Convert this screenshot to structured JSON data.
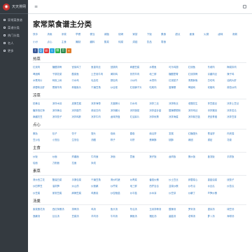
{
  "brand": {
    "name": "天天排网"
  },
  "sidebar": {
    "items": [
      {
        "label": "家常菜食谱"
      },
      {
        "label": "菜谱分类"
      },
      {
        "label": "热门分类"
      },
      {
        "label": "名人"
      },
      {
        "label": "更多"
      }
    ]
  },
  "topbar": {
    "toggle": "≡"
  },
  "page": {
    "title": "家常菜食谱主分类"
  },
  "alpha": [
    "快手",
    "汤羹",
    "凉菜",
    "早餐",
    "便当",
    "减脂",
    "烧烤",
    "家宴",
    "下饭",
    "素食",
    "甜点",
    "面食",
    "火锅",
    "卤味",
    "汤粥",
    "小炒",
    "点心",
    "主食",
    "腌制",
    "酱料",
    "蒸菜",
    "炖菜",
    "烘焙",
    "饮品",
    "零食"
  ],
  "share": [
    {
      "label": "f",
      "color": "#3b5998"
    },
    {
      "label": "Q",
      "color": "#4ca0e0"
    },
    {
      "label": "W",
      "color": "#e0373a"
    },
    {
      "label": "t",
      "color": "#2ea7e0"
    },
    {
      "label": "微",
      "color": "#2eb24b"
    },
    {
      "label": "豆",
      "color": "#2c8c4e"
    },
    {
      "label": "+",
      "color": "#e07b28"
    }
  ],
  "sections": [
    {
      "title": "热菜",
      "links": [
        "红烧肉",
        "糖醋排骨",
        "宫保鸡丁",
        "鱼香肉丝",
        "回锅肉",
        "麻婆豆腐",
        "水煮鱼",
        "可乐鸡翅",
        "红烧鱼",
        "东坡肉",
        "梅菜扣肉",
        "啤酒鸭",
        "干锅花菜",
        "酸菜鱼",
        "土豆烧牛肉",
        "黄焖鸡",
        "孜然羊肉",
        "地三鲜",
        "糖醋里脊",
        "红烧排骨",
        "京酱肉丝",
        "辣子鸡",
        "水煮肉片",
        "蚂蚁上树",
        "口水鸡",
        "毛血旺",
        "锅包肉",
        "小炒肉",
        "木须肉",
        "红烧茄子",
        "清蒸鲈鱼",
        "白切鸡",
        "油焖大虾",
        "蒜蓉粉丝虾",
        "葱爆羊肉",
        "剁椒鱼头",
        "干煸豆角",
        "炒合菜",
        "红烧狮子头",
        "咕咾肉",
        "香辣蟹",
        "啤酒鸡",
        "双椒鸡",
        "蒜苔炒肉"
      ]
    },
    {
      "title": "凉菜",
      "links": [
        "拍黄瓜",
        "凉拌木耳",
        "皮蛋豆腐",
        "凉拌海带",
        "夫妻肺片",
        "口水鸡",
        "凉拌三丝",
        "凉拌粉丝",
        "老醋花生",
        "拌豆腐丝",
        "凉拌土豆丝",
        "糖拌西红柿",
        "凉拌黄瓜",
        "凉拌腐竹",
        "蒜泥白肉",
        "凉拌藕片",
        "凉拌菠菜",
        "凉拌金针菇",
        "酸辣蕨根粉",
        "凉拌鸡丝",
        "凉拌猪耳",
        "凉拌苦瓜",
        "麻酱豇豆",
        "凉拌茄子",
        "凉拌鸡胗",
        "凉拌牛肉",
        "卤味拼盘",
        "红油耳片",
        "凉拌秋葵",
        "凉拌海蜇",
        "凉拌紫甘蓝",
        "虎皮青椒",
        "凉拌豆芽"
      ]
    },
    {
      "title": "点心",
      "links": [
        "蛋挞",
        "包子",
        "饺子",
        "馒头",
        "烧卖",
        "春卷",
        "南瓜饼",
        "发糕",
        "红糖馒头",
        "葱油饼",
        "肉夹馍",
        "豆沙包",
        "小笼包",
        "生煎包",
        "汤圆",
        "粽子",
        "月饼",
        "蛋黄酥",
        "桃酥",
        "麻团",
        "锅贴",
        "花卷"
      ]
    },
    {
      "title": "主食",
      "links": [
        "炒饭",
        "炒面",
        "炸酱面",
        "牛肉面",
        "凉面",
        "意面",
        "煲仔饭",
        "卤肉饭",
        "蛋炒饭",
        "盖浇饭",
        "手抓饭",
        "烩面",
        "刀削面",
        "拉面",
        "米线"
      ]
    },
    {
      "title": "素菜",
      "links": [
        "清炒西兰花",
        "醋溜白菜",
        "手撕包菜",
        "干煸豆角",
        "清炒时蔬",
        "炒青菜",
        "番茄炒蛋",
        "炒土豆丝",
        "蒜蓉菜心",
        "香菇油菜",
        "烧茄子",
        "炒四季豆",
        "油焖笋",
        "炒山药",
        "炒莲藕",
        "炒芹菜",
        "地三鲜",
        "西芹百合",
        "韭菜炒蛋",
        "炒冬瓜",
        "炒丝瓜",
        "炒苦瓜",
        "炒豆腐",
        "家常豆腐",
        "麻辣豆腐",
        "鸡蛋羹",
        "炒杏鲍菇",
        "炒平菇",
        "炒木耳",
        "炒豆芽",
        "炒藕丁",
        "芦笋炒蛋"
      ]
    },
    {
      "title": "汤羹",
      "links": [
        "紫菜蛋花汤",
        "西红柿蛋汤",
        "排骨汤",
        "鸡汤",
        "鱼头汤",
        "冬瓜汤",
        "玉米排骨汤",
        "酸辣汤",
        "罗宋汤",
        "银耳汤",
        "绿豆汤",
        "莲藕汤",
        "丝瓜汤",
        "豆腐汤",
        "羊肉汤",
        "牛肉汤",
        "鲫鱼汤",
        "猪肚汤",
        "菌菇汤",
        "老鸭汤",
        "萝卜汤",
        "海带汤"
      ]
    }
  ]
}
